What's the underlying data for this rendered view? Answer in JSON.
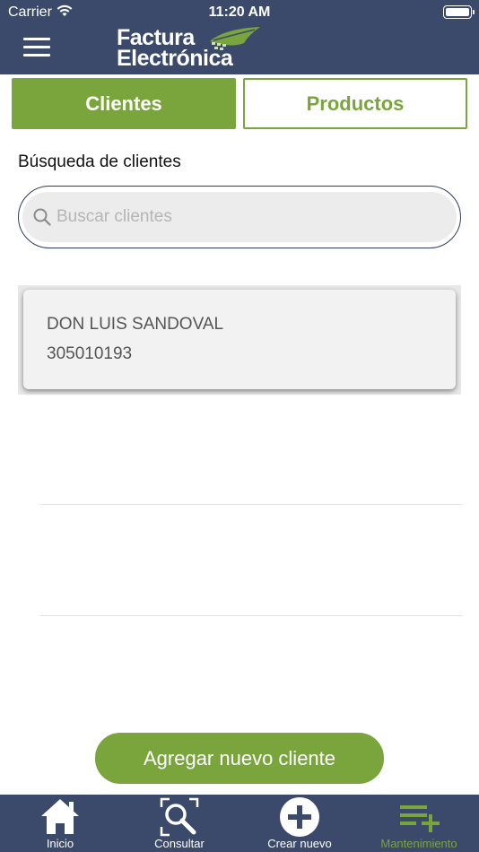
{
  "status_bar": {
    "carrier": "Carrier",
    "time": "11:20 AM"
  },
  "header": {
    "logo_line1": "Factura",
    "logo_line2": "Electrónica",
    "menu_icon": "hamburger-menu-icon"
  },
  "tabs": [
    {
      "label": "Clientes",
      "active": true
    },
    {
      "label": "Productos",
      "active": false
    }
  ],
  "search": {
    "section_label": "Búsqueda de clientes",
    "placeholder": "Buscar clientes",
    "value": ""
  },
  "clients": [
    {
      "name": "DON LUIS SANDOVAL",
      "id": "305010193"
    }
  ],
  "add_button_label": "Agregar nuevo cliente",
  "tabbar": [
    {
      "label": "Inicio",
      "icon": "home-icon",
      "active": false
    },
    {
      "label": "Consultar",
      "icon": "search-scan-icon",
      "active": false
    },
    {
      "label": "Crear nuevo",
      "icon": "plus-circle-icon",
      "active": false
    },
    {
      "label": "Mantenimiento",
      "icon": "list-add-icon",
      "active": true
    }
  ],
  "colors": {
    "header_bg": "#3b4a6b",
    "accent_green": "#7aa53c",
    "white": "#ffffff"
  }
}
